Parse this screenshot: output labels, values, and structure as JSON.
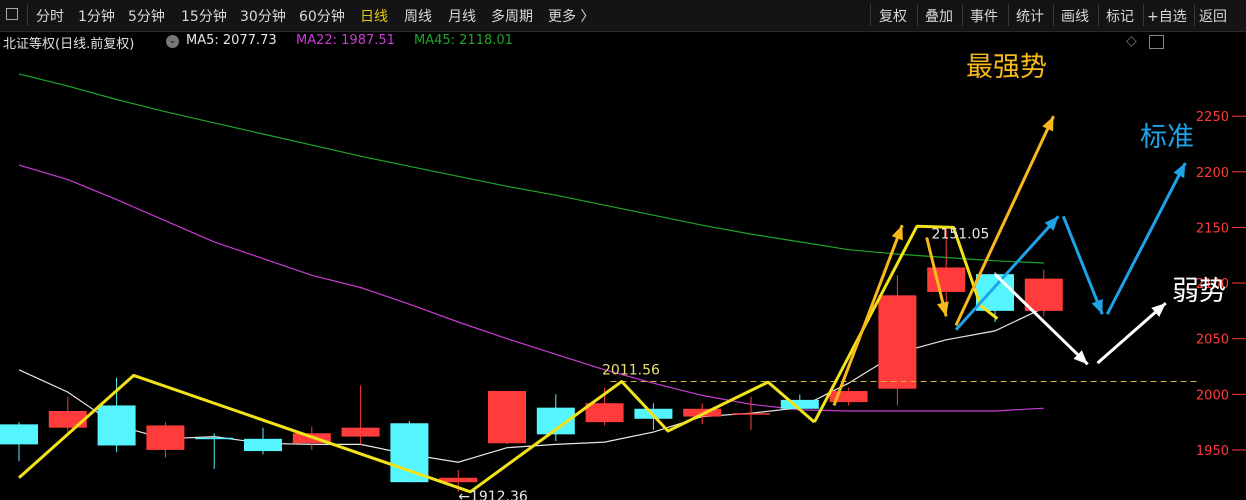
{
  "toolbar": {
    "periods": [
      "分时",
      "1分钟",
      "5分钟",
      "15分钟",
      "30分钟",
      "60分钟",
      "日线",
      "周线",
      "月线",
      "多周期",
      "更多 〉"
    ],
    "active_period": "日线",
    "tools": [
      "复权",
      "叠加",
      "事件",
      "统计",
      "画线",
      "标记",
      "+自选",
      "返回"
    ]
  },
  "info": {
    "title": "北证等权(日线.前复权)",
    "ma5_label": "MA5: 2077.73",
    "ma22_label": "MA22: 1987.51",
    "ma45_label": "MA45: 2118.01"
  },
  "colors": {
    "up": "#ff3b3b",
    "down": "#55f5ff",
    "ma5": "#e6e6e6",
    "ma22": "#c83cd6",
    "ma45": "#1ea52c",
    "yellow": "#f2e21a",
    "orange": "#f7b91b",
    "blue": "#1fa3e8",
    "white": "#ffffff"
  },
  "chart_data": {
    "type": "candlestick",
    "ylim": [
      1905,
      2305
    ],
    "y_ticks": [
      1950,
      2000,
      2050,
      2100,
      2150,
      2200,
      2250
    ],
    "candles": [
      {
        "o": 1973,
        "c": 1955,
        "h": 1975,
        "l": 1940
      },
      {
        "o": 1970,
        "c": 1985,
        "h": 1998,
        "l": 1965
      },
      {
        "o": 1990,
        "c": 1954,
        "h": 2015,
        "l": 1948
      },
      {
        "o": 1950,
        "c": 1972,
        "h": 1975,
        "l": 1943
      },
      {
        "o": 1961,
        "c": 1960,
        "h": 1965,
        "l": 1933
      },
      {
        "o": 1960,
        "c": 1949,
        "h": 1970,
        "l": 1946
      },
      {
        "o": 1956,
        "c": 1965,
        "h": 1971,
        "l": 1950
      },
      {
        "o": 1962,
        "c": 1970,
        "h": 2008,
        "l": 1955
      },
      {
        "o": 1974,
        "c": 1921,
        "h": 1976,
        "l": 1921
      },
      {
        "o": 1921,
        "c": 1925,
        "h": 1932,
        "l": 1912.36
      },
      {
        "o": 1956,
        "c": 2003,
        "h": 2003,
        "l": 1955
      },
      {
        "o": 1988,
        "c": 1964,
        "h": 2000,
        "l": 1958
      },
      {
        "o": 1975,
        "c": 1992,
        "h": 2006,
        "l": 1972
      },
      {
        "o": 1987,
        "c": 1978,
        "h": 1992,
        "l": 1968
      },
      {
        "o": 1980,
        "c": 1987,
        "h": 1992,
        "l": 1973
      },
      {
        "o": 1982,
        "c": 1983,
        "h": 1998,
        "l": 1968
      },
      {
        "o": 1995,
        "c": 1987,
        "h": 2000,
        "l": 1986
      },
      {
        "o": 1993,
        "c": 2003,
        "h": 2006,
        "l": 1990
      },
      {
        "o": 2005,
        "c": 2089,
        "h": 2107,
        "l": 1990
      },
      {
        "o": 2092,
        "c": 2114,
        "h": 2151.05,
        "l": 2080
      },
      {
        "o": 2108,
        "c": 2075,
        "h": 2110,
        "l": 2065
      },
      {
        "o": 2075,
        "c": 2104,
        "h": 2112,
        "l": 2070
      }
    ],
    "ma5": [
      2022,
      2002,
      1972,
      1960,
      1962,
      1956,
      1955,
      1955,
      1946,
      1939,
      1952,
      1955,
      1957,
      1966,
      1980,
      1983,
      1988,
      2010,
      2037,
      2049,
      2057,
      2077.73
    ],
    "ma22": [
      2206,
      2193,
      2175,
      2156,
      2137,
      2122,
      2107,
      2096,
      2081,
      2065,
      2050,
      2036,
      2022,
      2010,
      1999,
      1991,
      1986,
      1985,
      1985,
      1985,
      1985,
      1987.51
    ],
    "ma45": [
      2288,
      2277,
      2265,
      2254,
      2244,
      2234,
      2224,
      2214,
      2205,
      2196,
      2187,
      2179,
      2170,
      2161,
      2152,
      2144,
      2137,
      2130,
      2126,
      2123,
      2120,
      2118.01
    ],
    "dashed_level": 2011.56,
    "annotations": {
      "high_label": "2151.05",
      "low_label": "1912.36",
      "level_label": "2011.56",
      "strongest": "最强势",
      "standard": "标准",
      "weak": "弱势"
    }
  }
}
